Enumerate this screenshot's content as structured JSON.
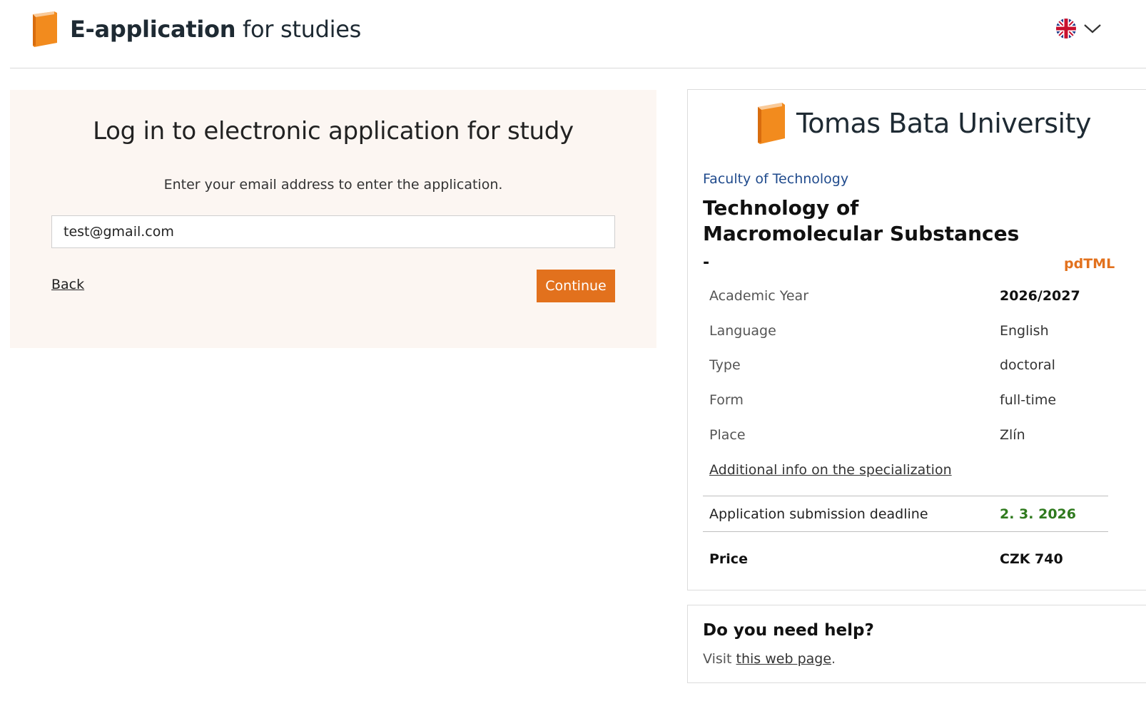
{
  "header": {
    "title_strong": "E-application",
    "title_rest": " for studies",
    "logo_icon": "book-icon",
    "language_icon": "uk-flag-icon"
  },
  "login": {
    "heading": "Log in to electronic application for study",
    "instruction": "Enter your email address to enter the application.",
    "email_value": "test@gmail.com",
    "back_label": "Back",
    "continue_label": "Continue"
  },
  "program": {
    "university": "Tomas Bata University",
    "faculty": "Faculty of Technology",
    "name": "Technology of Macromolecular Substances",
    "dash": "-",
    "code": "pdTML",
    "details": [
      {
        "label": "Academic Year",
        "value": "2026/2027"
      },
      {
        "label": "Language",
        "value": "English"
      },
      {
        "label": "Type",
        "value": "doctoral"
      },
      {
        "label": "Form",
        "value": "full-time"
      },
      {
        "label": "Place",
        "value": "Zlín"
      }
    ],
    "info_link": "Additional info on the specialization",
    "deadline_label": "Application submission deadline",
    "deadline_value": "2. 3. 2026",
    "price_label": "Price",
    "price_value": "CZK 740"
  },
  "help": {
    "heading": "Do you need help?",
    "text_before": "Visit ",
    "link": "this web page",
    "text_after": "."
  },
  "colors": {
    "accent": "#e2711d",
    "faculty_blue": "#1f4a8c",
    "deadline_green": "#2f7a1e",
    "login_bg": "#fcf6f2"
  }
}
